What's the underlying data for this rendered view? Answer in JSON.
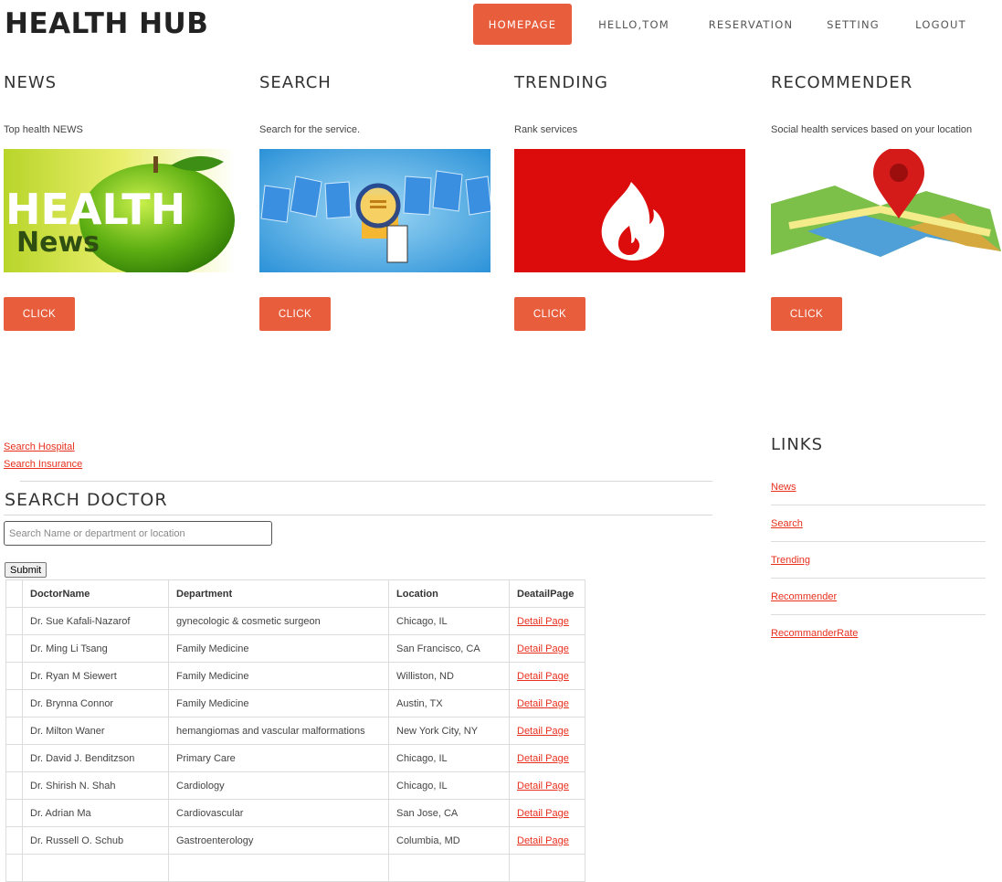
{
  "brand": "HEALTH HUB",
  "nav": [
    "HOMEPAGE",
    "HELLO,TOM",
    "RESERVATION",
    "SETTING",
    "LOGOUT"
  ],
  "features": [
    {
      "title": "NEWS",
      "desc": "Top health NEWS",
      "button": "CLICK",
      "image_text": [
        "HEALTH",
        "News"
      ]
    },
    {
      "title": "SEARCH",
      "desc": "Search for the service.",
      "button": "CLICK"
    },
    {
      "title": "TRENDING",
      "desc": "Rank services",
      "button": "CLICK"
    },
    {
      "title": "RECOMMENDER",
      "desc": "Social health services based on your location",
      "button": "CLICK"
    }
  ],
  "top_links": [
    "Search Hospital",
    "Search Insurance"
  ],
  "search": {
    "title": "SEARCH DOCTOR",
    "placeholder": "Search Name or department or location",
    "submit": "Submit"
  },
  "table": {
    "headers": [
      "",
      "DoctorName",
      "Department",
      "Location",
      "DeatailPage"
    ],
    "rows": [
      [
        "Dr. Sue Kafali-Nazarof",
        "gynecologic & cosmetic surgeon",
        "Chicago, IL",
        "Detail Page"
      ],
      [
        "Dr. Ming Li Tsang",
        "Family Medicine",
        "San Francisco, CA",
        "Detail Page"
      ],
      [
        "Dr. Ryan M Siewert",
        "Family Medicine",
        "Williston, ND",
        "Detail Page"
      ],
      [
        "Dr. Brynna Connor",
        "Family Medicine",
        "Austin, TX",
        "Detail Page"
      ],
      [
        "Dr. Milton Waner",
        "hemangiomas and vascular malformations",
        "New York City, NY",
        "Detail Page"
      ],
      [
        "Dr. David J. Benditzson",
        "Primary Care",
        "Chicago, IL",
        "Detail Page"
      ],
      [
        "Dr. Shirish N. Shah",
        "Cardiology",
        "Chicago, IL",
        "Detail Page"
      ],
      [
        "Dr. Adrian Ma",
        "Cardiovascular",
        "San Jose, CA",
        "Detail Page"
      ],
      [
        "Dr. Russell O. Schub",
        "Gastroenterology",
        "Columbia, MD",
        "Detail Page"
      ],
      [
        "",
        "",
        "",
        ""
      ]
    ]
  },
  "links": {
    "title": "LINKS",
    "items": [
      "News",
      "Search",
      "Trending",
      "Recommender",
      "RecommanderRate"
    ]
  },
  "colors": {
    "accent": "#e85e3d",
    "link": "#e8301e",
    "trending_bg": "#dd0c0c"
  },
  "icons": [
    "apple-news-image",
    "search-documents-image",
    "flame-icon",
    "map-pin-icon"
  ]
}
